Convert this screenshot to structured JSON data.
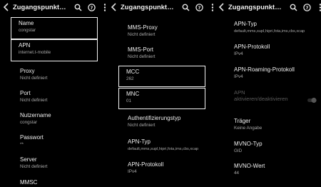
{
  "screens": [
    {
      "title": "Zugangspunkt…",
      "items": [
        {
          "label": "Name",
          "value": "congstar"
        },
        {
          "label": "APN",
          "value": "internet.t-mobile"
        },
        {
          "label": "Proxy",
          "value": "Nicht definiert"
        },
        {
          "label": "Port",
          "value": "Nicht definiert"
        },
        {
          "label": "Nutzername",
          "value": "congstar"
        },
        {
          "label": "Passwort",
          "value": "**"
        },
        {
          "label": "Server",
          "value": "Nicht definiert"
        },
        {
          "label": "MMSC",
          "value": ""
        }
      ]
    },
    {
      "title": "Zugangspunkt…",
      "items": [
        {
          "label": "MMS-Proxy",
          "value": "Nicht definiert"
        },
        {
          "label": "MMS-Port",
          "value": "Nicht definiert"
        },
        {
          "label": "MCC",
          "value": "262"
        },
        {
          "label": "MNC",
          "value": "01"
        },
        {
          "label": "Authentifizierungstyp",
          "value": "Nicht definiert"
        },
        {
          "label": "APN-Typ",
          "value": "default,mms,supl,hipri,fota,ims,cbs,xcap"
        },
        {
          "label": "APN-Protokoll",
          "value": "IPv4"
        }
      ]
    },
    {
      "title": "Zugangspunkt…",
      "items": [
        {
          "label": "APN-Typ",
          "value": "default,mms,supl,hipri,fota,ims,cbs,xcap"
        },
        {
          "label": "APN-Protokoll",
          "value": "IPv4"
        },
        {
          "label": "APN-Roaming-Protokoll",
          "value": "IPv4"
        },
        {
          "label": "APN aktivieren/deaktivieren",
          "value": "",
          "toggle": "off"
        },
        {
          "label": "Träger",
          "value": "Keine Angabe"
        },
        {
          "label": "MVNO-Typ",
          "value": "GID"
        },
        {
          "label": "MVNO-Wert",
          "value": "44"
        }
      ]
    }
  ],
  "icons": [
    "back-arrow-icon",
    "search-icon",
    "help-icon",
    "more-vert-icon"
  ],
  "colors": {
    "background": "#000000",
    "text": "#efefef",
    "secondary": "#a8a8a8",
    "highlight_border": "#f4f4f4"
  }
}
